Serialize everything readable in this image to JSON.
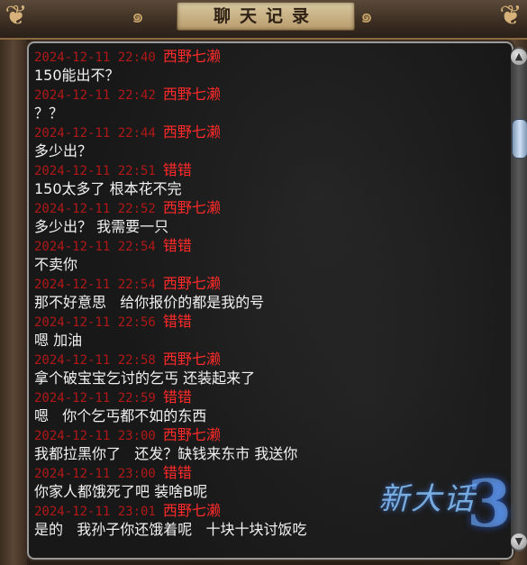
{
  "window": {
    "title": "聊天记录"
  },
  "colors": {
    "timestamp": "#b01818",
    "sender": "#ff2a2a",
    "message": "#f2f2f2",
    "panel_bg": "#181818"
  },
  "messages": [
    {
      "time": "2024-12-11 22:40",
      "sender": "西野七濑",
      "text": "150能出不？"
    },
    {
      "time": "2024-12-11 22:42",
      "sender": "西野七濑",
      "text": "？？"
    },
    {
      "time": "2024-12-11 22:44",
      "sender": "西野七濑",
      "text": "多少出？"
    },
    {
      "time": "2024-12-11 22:51",
      "sender": "错错",
      "text": "150太多了 根本花不完"
    },
    {
      "time": "2024-12-11 22:52",
      "sender": "西野七濑",
      "text": "多少出？ 我需要一只"
    },
    {
      "time": "2024-12-11 22:54",
      "sender": "错错",
      "text": "不卖你"
    },
    {
      "time": "2024-12-11 22:54",
      "sender": "西野七濑",
      "text": "那不好意思   给你报价的都是我的号"
    },
    {
      "time": "2024-12-11 22:56",
      "sender": "错错",
      "text": "嗯 加油"
    },
    {
      "time": "2024-12-11 22:58",
      "sender": "西野七濑",
      "text": "拿个破宝宝乞讨的乞丐 还装起来了"
    },
    {
      "time": "2024-12-11 22:59",
      "sender": "错错",
      "text": "嗯   你个乞丐都不如的东西"
    },
    {
      "time": "2024-12-11 23:00",
      "sender": "西野七濑",
      "text": "我都拉黑你了   还发？缺钱来东市 我送你"
    },
    {
      "time": "2024-12-11 23:00",
      "sender": "错错",
      "text": "你家人都饿死了吧 装啥B呢"
    },
    {
      "time": "2024-12-11 23:01",
      "sender": "西野七濑",
      "text": "是的   我孙子你还饿着呢   十块十块讨饭吃"
    }
  ],
  "logo": {
    "name": "新大话",
    "number": "3"
  },
  "icons": {
    "scroll_up": "triangle-up",
    "scroll_down": "triangle-down"
  }
}
